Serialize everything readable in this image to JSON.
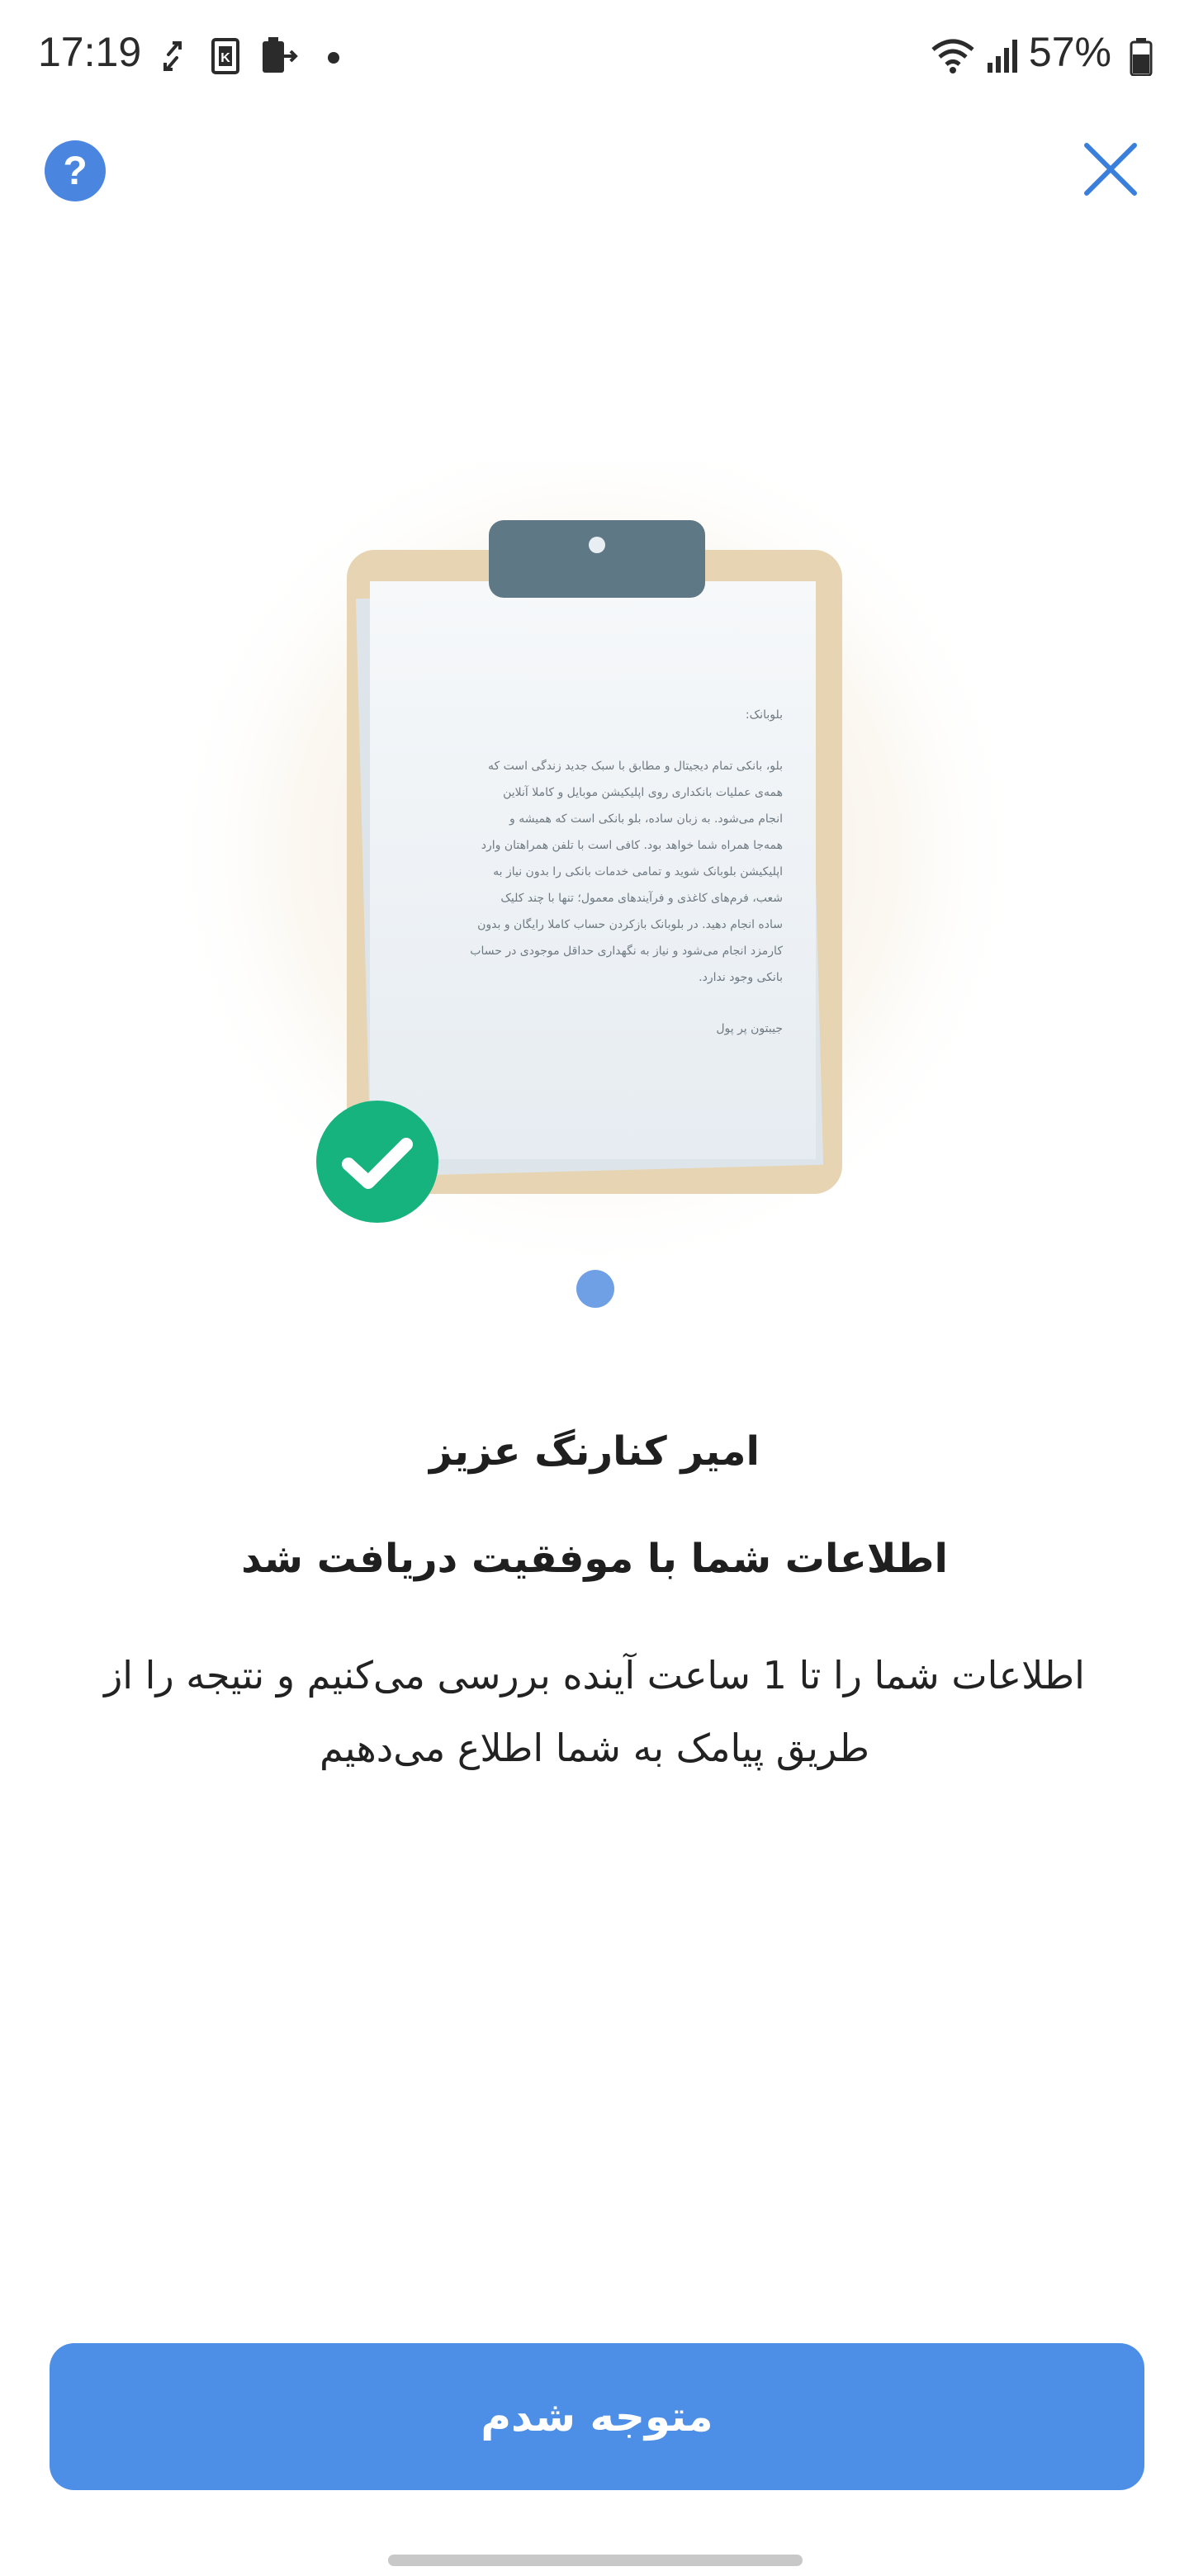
{
  "status_bar": {
    "time": "17:19",
    "battery": "57%",
    "icons": [
      "sync-icon",
      "k-app-icon",
      "battery-saver-icon",
      "dot-icon",
      "wifi-icon",
      "signal-icon",
      "battery-icon"
    ]
  },
  "header": {
    "help_label": "?",
    "help_icon": "question-circle-icon",
    "close_icon": "close-icon"
  },
  "illustration": {
    "doc_title": "بلوبانک:",
    "doc_body": [
      "بلو، بانکی تمام دیجیتال و مطابق با سبک جدید زندگی است که",
      "همه‌ی عملیات بانکداری روی اپلیکیشن موبایل و کاملا آنلاین",
      "انجام می‌شود. به زبان ساده، بلو بانکی است که همیشه و",
      "همه‌جا همراه شما خواهد بود. کافی است با تلفن همراهتان وارد",
      "اپلیکیشن بلوبانک شوید و تمامی خدمات بانکی را بدون نیاز به",
      "شعب، فرم‌های کاغذی و فرآیندهای معمول؛ تنها با چند کلیک",
      "ساده انجام دهید. در بلوبانک بازکردن حساب کاملا رایگان و بدون",
      "کارمزد انجام می‌شود و نیاز به نگهداری حداقل موجودی در حساب",
      "بانکی وجود ندارد."
    ],
    "doc_signature": "جیبتون پر پول"
  },
  "content": {
    "greeting": "امیر کنارنگ عزیز",
    "success_message": "اطلاعات شما با موفقیت دریافت شد",
    "description": "اطلاعات شما را تا 1 ساعت آینده بررسی می‌کنیم و نتیجه را از طریق پیامک به شما اطلاع می‌دهیم"
  },
  "actions": {
    "acknowledge_label": "متوجه شدم"
  },
  "colors": {
    "accent": "#4d8ee6",
    "success": "#17b37f",
    "clip": "#5f7886",
    "board": "#e6d4b3"
  }
}
